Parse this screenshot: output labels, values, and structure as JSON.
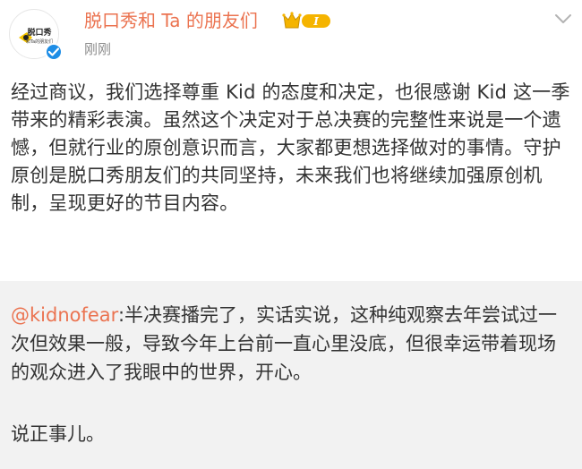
{
  "header": {
    "avatar_title": "脱口秀",
    "avatar_subtitle": "和Ta的朋友们",
    "username": "脱口秀和 Ta 的朋友们",
    "member_badge_level": "I",
    "timestamp": "刚刚",
    "colors": {
      "username": "#eb7350",
      "badge": "#f5b400",
      "verified": "#1d8de6"
    }
  },
  "post": {
    "text": "经过商议，我们选择尊重 Kid 的态度和决定，也很感谢 Kid 这一季带来的精彩表演。虽然这个决定对于总决赛的完整性来说是一个遗憾，但就行业的原创意识而言，大家都更想选择做对的事情。守护原创是脱口秀朋友们的共同坚持，未来我们也将继续加强原创机制，呈现更好的节目内容。"
  },
  "repost": {
    "mention": "@kidnofear",
    "text": ":半决赛播完了，实话实说，这种纯观察去年尝试过一次但效果一般，导致今年上台前一直心里没底，但很幸运带着现场的观众进入了我眼中的世界，开心。",
    "sub_text": "说正事儿。",
    "colors": {
      "background": "#f2f2f2",
      "mention": "#eb7350"
    }
  }
}
